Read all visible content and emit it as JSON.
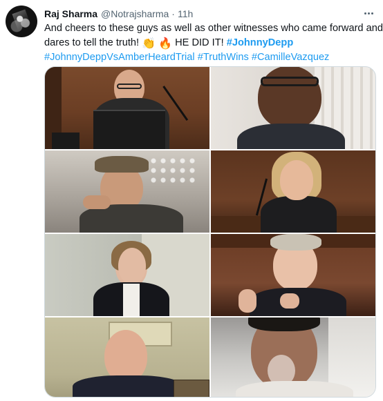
{
  "tweet": {
    "author": {
      "name": "Raj Sharma",
      "handle": "@Notrajsharma",
      "separator": "·",
      "time": "11h"
    },
    "text": {
      "line1": "And cheers to these guys as well as other witnesses who came forward and",
      "line2_text": "dares to tell the truth!",
      "line2_emoji1": "👏",
      "line2_emoji2": "🔥",
      "line2_after": "HE DID IT!",
      "line2_tag": "#JohnnyDepp",
      "line3_tags": [
        "#JohnnyDeppVsAmberHeardTrial",
        "#TruthWins",
        "#CamilleVazquez"
      ]
    },
    "media": {
      "cells": [
        {
          "id": "judge-feed",
          "icon": "judge-video-thumbnail"
        },
        {
          "id": "witness-feed-glasses",
          "icon": "witness-video-thumbnail"
        },
        {
          "id": "witness-feed-hat",
          "icon": "witness-video-thumbnail"
        },
        {
          "id": "witness-feed-stand",
          "icon": "witness-video-thumbnail"
        },
        {
          "id": "witness-feed-remote",
          "icon": "witness-video-thumbnail"
        },
        {
          "id": "witness-feed-gesture",
          "icon": "witness-video-thumbnail"
        },
        {
          "id": "witness-feed-office",
          "icon": "witness-video-thumbnail"
        },
        {
          "id": "witness-feed-car",
          "icon": "witness-video-thumbnail"
        }
      ]
    },
    "colors": {
      "link": "#1d9bf0",
      "text": "#0f1419",
      "muted": "#536471",
      "border": "#cfd9de"
    },
    "icons": {
      "avatar": "profile-avatar",
      "more": "more-options-icon"
    }
  }
}
